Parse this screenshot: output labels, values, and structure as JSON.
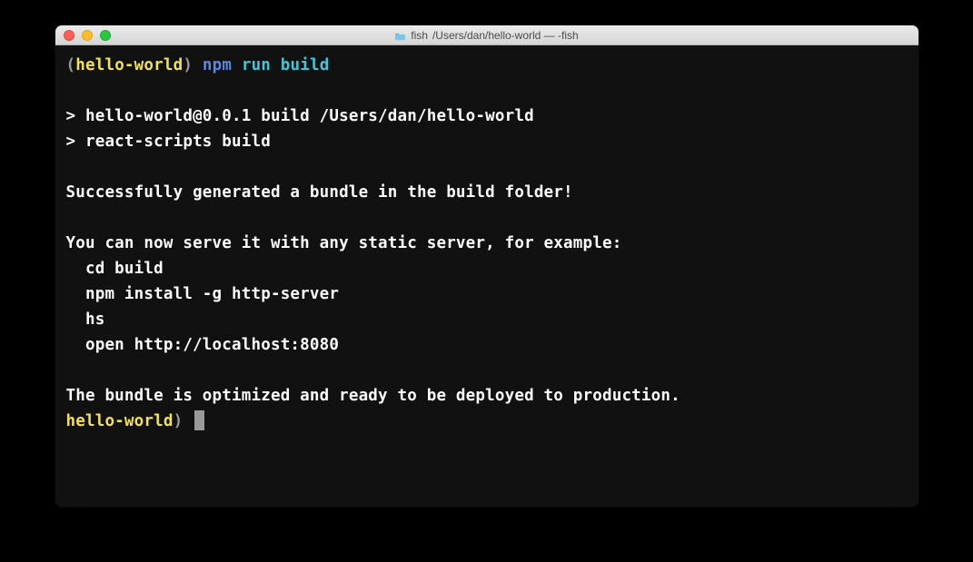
{
  "window": {
    "title_folder": "fish",
    "title_path": "/Users/dan/hello-world — -fish"
  },
  "prompt1": {
    "bracket_open": "(",
    "dir": "hello-world",
    "bracket_close": ")",
    "cmd_part1": "npm",
    "cmd_part2": "run",
    "cmd_part3": "build"
  },
  "output": {
    "line1": "> hello-world@0.0.1 build /Users/dan/hello-world",
    "line2": "> react-scripts build",
    "line3": "Successfully generated a bundle in the build folder!",
    "line4": "You can now serve it with any static server, for example:",
    "line5": "  cd build",
    "line6": "  npm install -g http-server",
    "line7": "  hs",
    "line8": "  open http://localhost:8080",
    "line9": "The bundle is optimized and ready to be deployed to production."
  },
  "prompt2": {
    "dir": "hello-world",
    "bracket_close": ")"
  }
}
